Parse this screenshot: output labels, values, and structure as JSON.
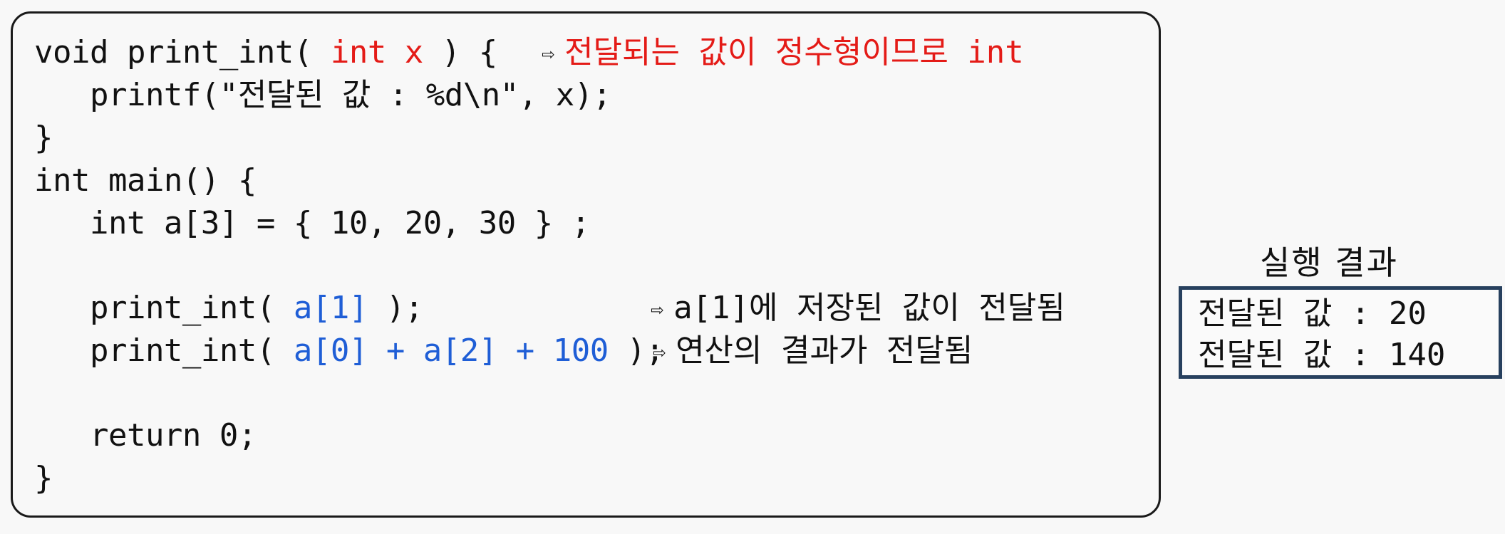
{
  "code": {
    "line1": {
      "kw": "void print_int( ",
      "param": "int x",
      "tail": " ) {"
    },
    "line2": "   printf(\"전달된 값 : %d\\n\", x);",
    "line3": "}",
    "line4": "int main() {",
    "line5": "   int a[3] = { 10, 20, 30 } ;",
    "line6": {
      "head": "   print_int( ",
      "arg": "a[1]",
      "tail": " );"
    },
    "line7": {
      "head": "   print_int( ",
      "arg": "a[0] + a[2] + 100",
      "tail": " );"
    },
    "line8": "   return 0;",
    "line9": "}"
  },
  "notes": {
    "arrow": "⇨",
    "note1": "전달되는 값이 정수형이므로 int",
    "note2": "a[1]에 저장된 값이 전달됨",
    "note3": "연산의 결과가 전달됨"
  },
  "result": {
    "title": "실행 결과",
    "lines": [
      "전달된 값 : 20",
      "전달된 값 : 140"
    ]
  },
  "colors": {
    "highlight_red": "#e41b17",
    "highlight_blue": "#1f5ed6",
    "result_border": "#27405e"
  }
}
